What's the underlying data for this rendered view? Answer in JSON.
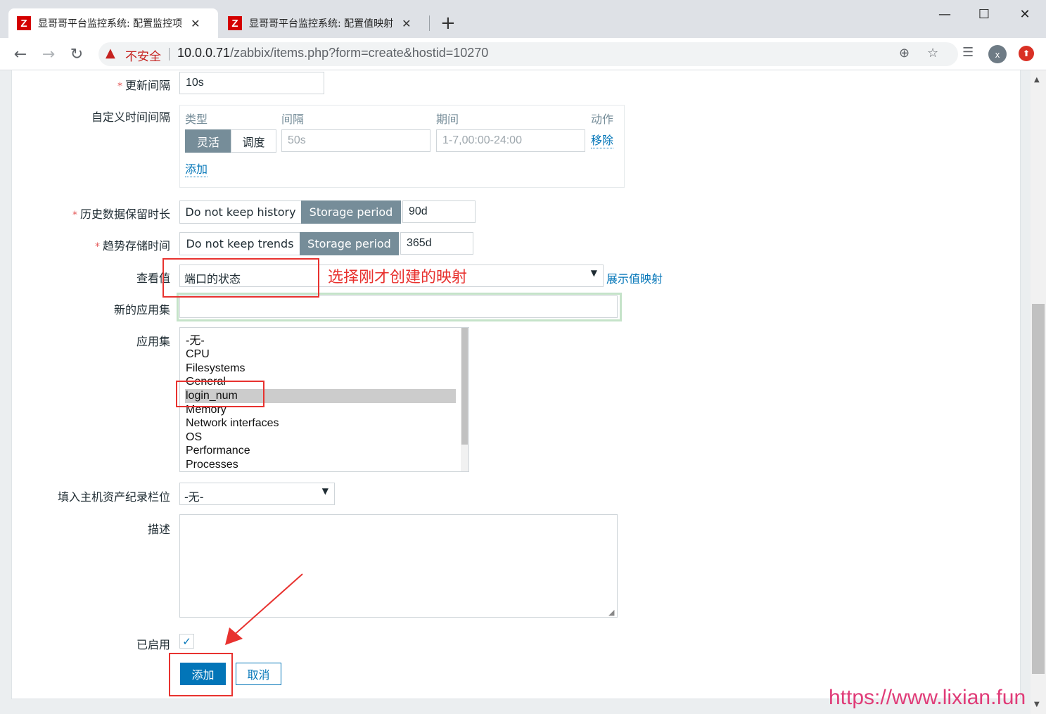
{
  "browser": {
    "tabs": [
      {
        "favicon": "Z",
        "title": "显哥哥平台监控系统: 配置监控项",
        "close": "✕"
      },
      {
        "favicon": "Z",
        "title": "显哥哥平台监控系统: 配置值映射",
        "close": "✕"
      }
    ],
    "new_tab": "+",
    "window": {
      "minimize": "—",
      "maximize": "☐",
      "close": "✕"
    },
    "nav": {
      "back": "←",
      "forward": "→",
      "reload": "↻"
    },
    "security_label": "不安全",
    "url_host": "10.0.0.71",
    "url_path": "/zabbix/items.php?form=create&hostid=10270",
    "profile_initial": "x",
    "icons": {
      "warning": "warning-icon",
      "zoom": "zoom-icon",
      "bookmark": "star-icon",
      "reading_list": "reading-list-icon",
      "update": "update-icon"
    }
  },
  "form": {
    "update_interval": {
      "label": "更新间隔",
      "value": "10s"
    },
    "custom_intervals": {
      "label": "自定义时间间隔",
      "col_type": "类型",
      "col_interval": "间隔",
      "col_period": "期间",
      "col_action": "动作",
      "type_flexible": "灵活",
      "type_scheduling": "调度",
      "interval_placeholder": "50s",
      "period_placeholder": "1-7,00:00-24:00",
      "remove": "移除",
      "add": "添加"
    },
    "history": {
      "label": "历史数据保留时长",
      "opt_off": "Do not keep history",
      "opt_on": "Storage period",
      "value": "90d"
    },
    "trends": {
      "label": "趋势存储时间",
      "opt_off": "Do not keep trends",
      "opt_on": "Storage period",
      "value": "365d"
    },
    "show_value": {
      "label": "查看值",
      "selected": "端口的状态",
      "link": "展示值映射"
    },
    "new_application": {
      "label": "新的应用集",
      "value": ""
    },
    "applications": {
      "label": "应用集",
      "options": [
        "-无-",
        "CPU",
        "Filesystems",
        "General",
        "login_num",
        "Memory",
        "Network interfaces",
        "OS",
        "Performance",
        "Processes"
      ],
      "selected_index": 4
    },
    "inventory": {
      "label": "填入主机资产纪录栏位",
      "selected": "-无-"
    },
    "description": {
      "label": "描述",
      "value": ""
    },
    "enabled": {
      "label": "已启用",
      "checked": true
    },
    "buttons": {
      "add": "添加",
      "cancel": "取消"
    }
  },
  "annotation": {
    "note": "选择刚才创建的映射",
    "color": "#e8322f"
  },
  "watermark": "https://www.lixian.fun",
  "colors": {
    "primary": "#0275b8",
    "segment_active": "#768d99",
    "required": "#e45959"
  }
}
